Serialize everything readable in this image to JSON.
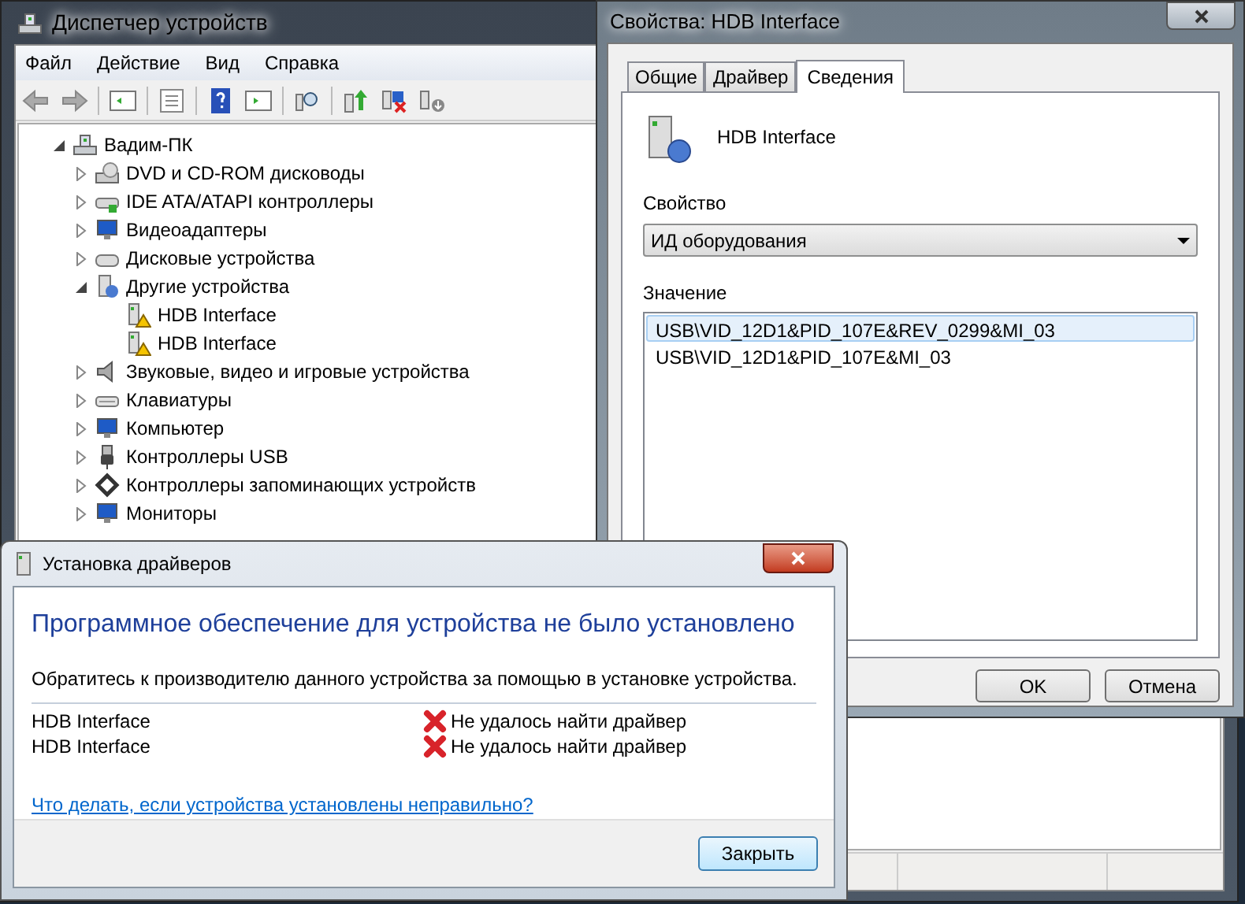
{
  "device_manager": {
    "title": "Диспетчер устройств",
    "menu": [
      "Файл",
      "Действие",
      "Вид",
      "Справка"
    ],
    "tree": {
      "label": "Вадим-ПК",
      "kind": "computer",
      "expanded": true,
      "children": [
        {
          "label": "DVD и CD-ROM дисководы",
          "kind": "dvd",
          "expanded": false
        },
        {
          "label": "IDE ATA/ATAPI контроллеры",
          "kind": "controller",
          "expanded": false
        },
        {
          "label": "Видеоадаптеры",
          "kind": "display",
          "expanded": false
        },
        {
          "label": "Дисковые устройства",
          "kind": "drive",
          "expanded": false
        },
        {
          "label": "Другие устройства",
          "kind": "unknown",
          "expanded": true,
          "children": [
            {
              "label": "HDB Interface",
              "kind": "device",
              "warning": true
            },
            {
              "label": "HDB Interface",
              "kind": "device",
              "warning": true
            }
          ]
        },
        {
          "label": "Звуковые, видео и игровые устройства",
          "kind": "speaker",
          "expanded": false
        },
        {
          "label": "Клавиатуры",
          "kind": "keyboard",
          "expanded": false
        },
        {
          "label": "Компьютер",
          "kind": "display",
          "expanded": false
        },
        {
          "label": "Контроллеры USB",
          "kind": "usb",
          "expanded": false
        },
        {
          "label": "Контроллеры запоминающих устройств",
          "kind": "storage",
          "expanded": false
        },
        {
          "label": "Мониторы",
          "kind": "display",
          "expanded": false
        }
      ]
    }
  },
  "properties": {
    "title": "Свойства: HDB Interface",
    "tabs": [
      {
        "label": "Общие",
        "selected": false
      },
      {
        "label": "Драйвер",
        "selected": false
      },
      {
        "label": "Сведения",
        "selected": true
      }
    ],
    "device_name": "HDB Interface",
    "property_label": "Свойство",
    "property_value": "ИД оборудования",
    "value_label": "Значение",
    "values": [
      {
        "text": "USB\\VID_12D1&PID_107E&REV_0299&MI_03",
        "selected": true
      },
      {
        "text": "USB\\VID_12D1&PID_107E&MI_03",
        "selected": false
      }
    ],
    "buttons": [
      "OK",
      "Отмена"
    ]
  },
  "driver_install": {
    "title": "Установка драйверов",
    "heading": "Программное обеспечение для устройства не было установлено",
    "message": "Обратитесь к производителю данного устройства за помощью в установке устройства.",
    "devices": [
      {
        "name": "HDB Interface",
        "status": "Не удалось найти драйвер",
        "failed": true
      },
      {
        "name": "HDB Interface",
        "status": "Не удалось найти драйвер",
        "failed": true
      }
    ],
    "link": "Что делать, если устройства установлены неправильно?",
    "close_button": "Закрыть"
  }
}
